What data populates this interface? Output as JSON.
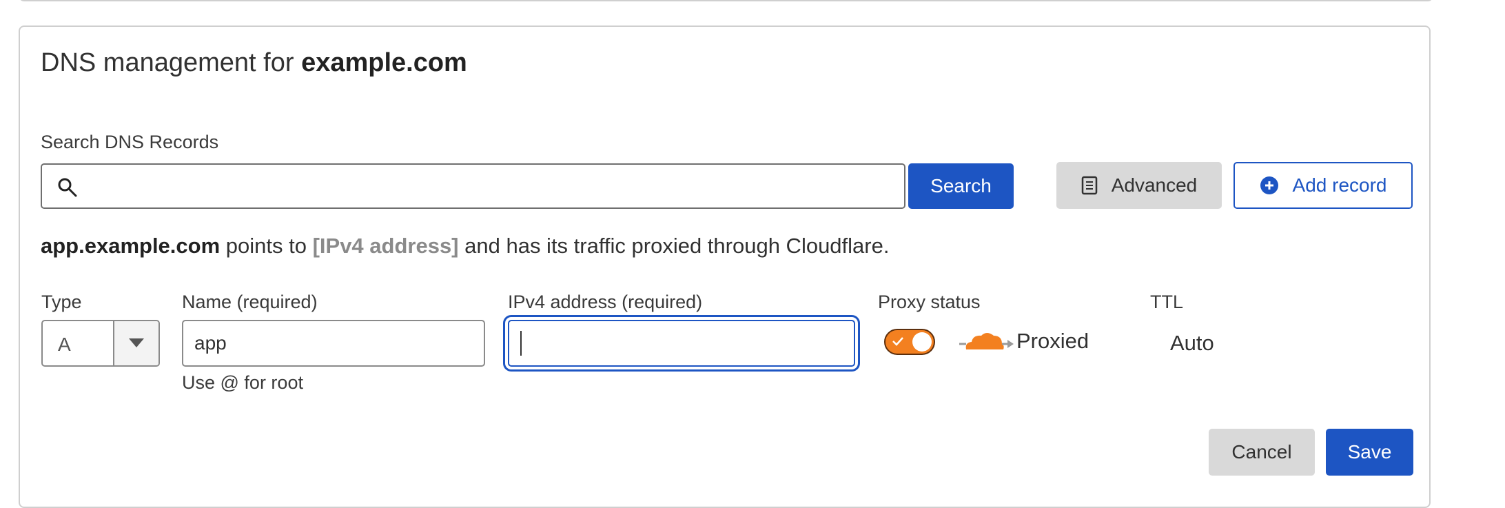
{
  "header": {
    "title_prefix": "DNS management for ",
    "title_domain": "example.com"
  },
  "search": {
    "label": "Search DNS Records",
    "value": "",
    "placeholder": "",
    "button_label": "Search"
  },
  "toolbar": {
    "advanced_label": "Advanced",
    "add_record_label": "Add record"
  },
  "summary": {
    "host": "app.example.com",
    "points_to": " points to ",
    "placeholder": "[IPv4 address]",
    "rest": " and has its traffic proxied through Cloudflare."
  },
  "form": {
    "type_label": "Type",
    "type_value": "A",
    "name_label": "Name (required)",
    "name_value": "app",
    "name_hint": "Use @ for root",
    "ipv4_label": "IPv4 address (required)",
    "ipv4_value": "",
    "proxy_label": "Proxy status",
    "proxy_value": "Proxied",
    "ttl_label": "TTL",
    "ttl_value": "Auto"
  },
  "actions": {
    "cancel_label": "Cancel",
    "save_label": "Save"
  },
  "colors": {
    "primary": "#1d55c3",
    "proxy_orange": "#f38020",
    "grey_button": "#d9d9d9"
  },
  "icons": {
    "search": "search-icon",
    "advanced": "document-icon",
    "add": "plus-circle-icon",
    "dropdown": "chevron-down-icon",
    "cloud": "cloud-icon"
  }
}
